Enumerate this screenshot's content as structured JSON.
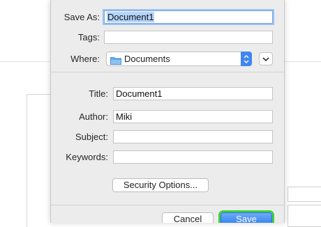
{
  "save_as": {
    "label": "Save As:",
    "value": "Document1"
  },
  "tags": {
    "label": "Tags:",
    "value": ""
  },
  "where": {
    "label": "Where:",
    "folder_icon": "folder-icon",
    "value": "Documents"
  },
  "metadata": {
    "title": {
      "label": "Title:",
      "value": "Document1"
    },
    "author": {
      "label": "Author:",
      "value": "Miki"
    },
    "subject": {
      "label": "Subject:",
      "value": ""
    },
    "keywords": {
      "label": "Keywords:",
      "value": ""
    }
  },
  "security_button": "Security Options...",
  "buttons": {
    "cancel": "Cancel",
    "save": "Save"
  },
  "colors": {
    "accent": "#3f86f3",
    "highlight": "#3fd13f",
    "selection": "#b4d4fb"
  }
}
